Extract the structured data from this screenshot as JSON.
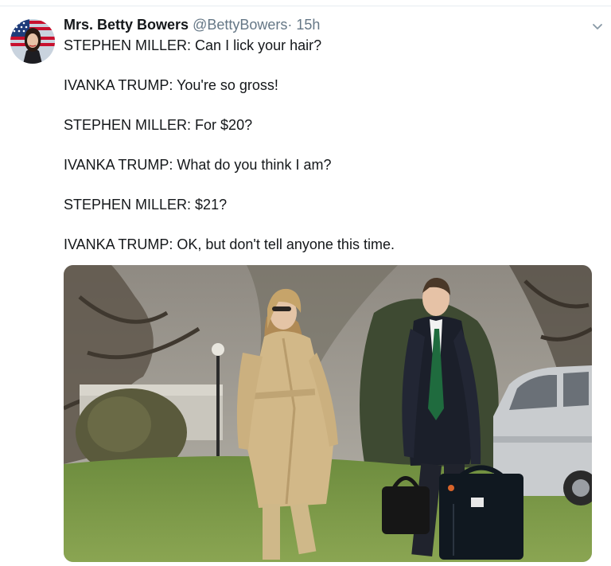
{
  "tweet": {
    "display_name": "Mrs. Betty Bowers",
    "handle": "@BettyBowers",
    "separator": "·",
    "time": "15h",
    "lines": [
      "STEPHEN MILLER: Can I lick your hair?",
      "IVANKA TRUMP: You're so gross!",
      "STEPHEN MILLER: For $20?",
      "IVANKA TRUMP: What do you think I am?",
      "STEPHEN MILLER: $21?",
      "IVANKA TRUMP: OK, but don't tell anyone this time."
    ]
  },
  "icons": {
    "menu": "chevron-down-icon"
  },
  "colors": {
    "text": "#14171a",
    "secondary_text": "#657786",
    "divider": "#e6ecf0"
  }
}
